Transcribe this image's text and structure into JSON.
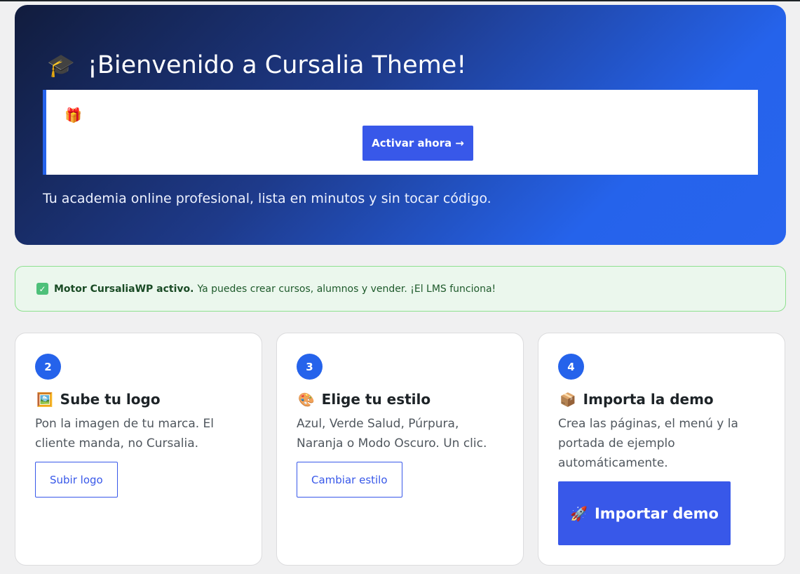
{
  "hero": {
    "icon": "🎓",
    "title": "¡Bienvenido a Cursalia Theme!",
    "notice_icon": "🎁",
    "activate_label": "Activar ahora →",
    "subtitle": "Tu academia online profesional, lista en minutos y sin tocar código."
  },
  "status": {
    "icon": "✓",
    "strong": "Motor CursaliaWP activo.",
    "text": "Ya puedes crear cursos, alumnos y vender. ¡El LMS funciona!"
  },
  "cards": [
    {
      "number": "2",
      "emoji": "🖼️",
      "title": "Sube tu logo",
      "description": "Pon la imagen de tu marca. El cliente manda, no Cursalia.",
      "button": "Subir logo"
    },
    {
      "number": "3",
      "emoji": "🎨",
      "title": "Elige tu estilo",
      "description": "Azul, Verde Salud, Púrpura, Naranja o Modo Oscuro. Un clic.",
      "button": "Cambiar estilo"
    },
    {
      "number": "4",
      "emoji": "📦",
      "title": "Importa la demo",
      "description": "Crea las páginas, el menú y la portada de ejemplo automáticamente.",
      "button_emoji": "🚀",
      "button": "Importar demo"
    }
  ],
  "colors": {
    "accent": "#3858e9",
    "hero_start": "#111c3d",
    "hero_end": "#2563eb",
    "success_bg": "#ebf7ed",
    "success_border": "#8ee08f"
  }
}
